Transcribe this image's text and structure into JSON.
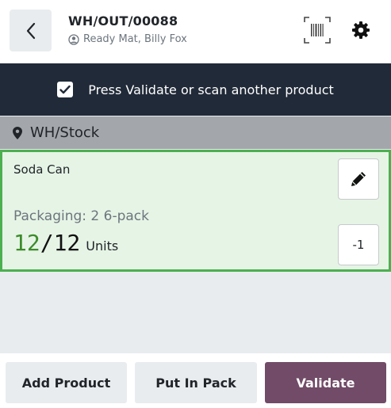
{
  "header": {
    "title": "WH/OUT/00088",
    "subtitle": "Ready Mat, Billy Fox",
    "icons": {
      "back": "chevron-left-icon",
      "barcode": "barcode-scanner-icon",
      "settings": "gear-icon",
      "user": "user-circle-icon"
    }
  },
  "banner": {
    "message": "Press Validate or scan another product",
    "checked": true
  },
  "location": {
    "name": "WH/Stock",
    "icon": "map-marker-icon"
  },
  "product": {
    "name": "Soda Can",
    "packaging": "Packaging: 2 6-pack",
    "qty_done": "12",
    "separator": "/",
    "qty_total": "12",
    "unit": "Units",
    "minus_label": "-1",
    "edit_icon": "pencil-icon"
  },
  "footer": {
    "add_product": "Add Product",
    "put_in_pack": "Put In Pack",
    "validate": "Validate"
  },
  "colors": {
    "banner_bg": "#212a38",
    "location_bg": "#a3a6ab",
    "card_bg": "#e6f4e6",
    "card_border": "#4caf50",
    "qty_done": "#3c8c2a",
    "validate_bg": "#714b67"
  }
}
